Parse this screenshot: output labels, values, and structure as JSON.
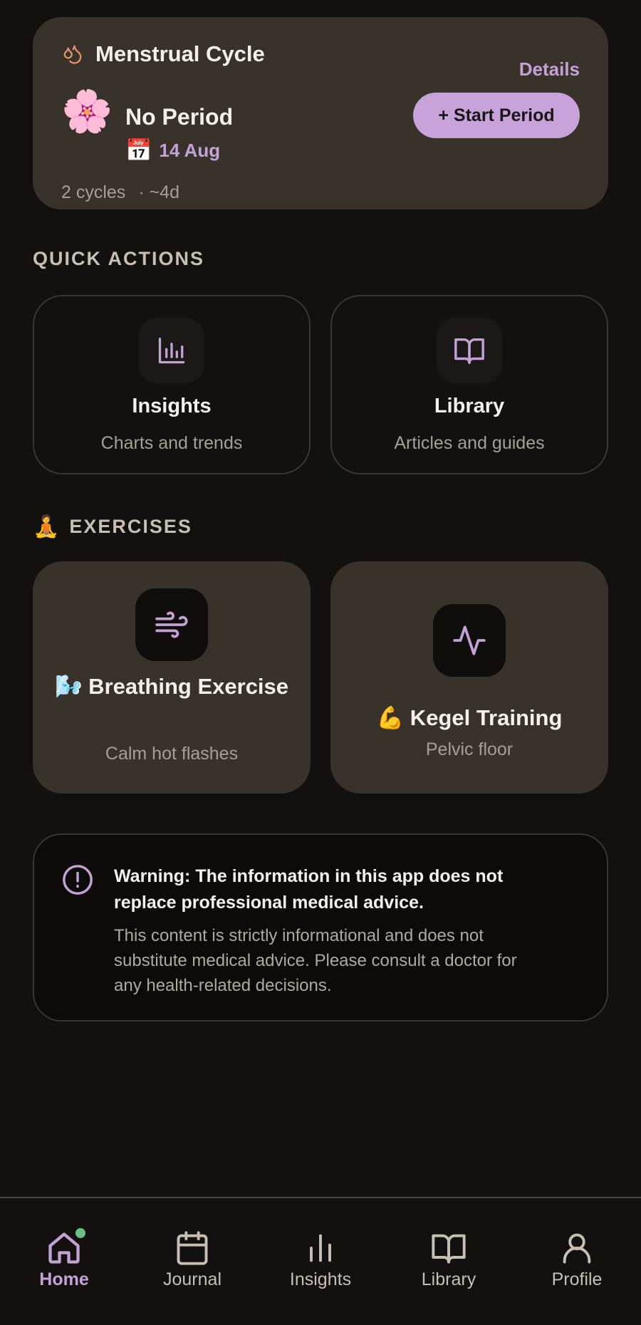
{
  "cycle": {
    "title": "Menstrual Cycle",
    "details_label": "Details",
    "status": "No Period",
    "date": "14 Aug",
    "start_button": "+ Start Period",
    "cycles_count": "2 cycles",
    "cycle_length": "· ~4d",
    "flower_emoji": "🌸",
    "calendar_emoji": "📅"
  },
  "quick_actions": {
    "title": "QUICK ACTIONS",
    "items": [
      {
        "title": "Insights",
        "subtitle": "Charts and trends",
        "icon": "bar-chart-icon"
      },
      {
        "title": "Library",
        "subtitle": "Articles and guides",
        "icon": "book-icon"
      }
    ]
  },
  "exercises": {
    "emoji": "🧘",
    "title": "EXERCISES",
    "items": [
      {
        "title": "🌬️ Breathing Exercise",
        "subtitle": "Calm hot flashes",
        "icon": "wind-icon"
      },
      {
        "title": "💪 Kegel Training",
        "subtitle": "Pelvic floor",
        "icon": "activity-icon"
      }
    ]
  },
  "warning": {
    "title": "Warning: The information in this app does not replace professional medical advice.",
    "body": "This content is strictly informational and does not substitute medical advice. Please consult a doctor for any health-related decisions."
  },
  "nav": {
    "items": [
      {
        "label": "Home",
        "icon": "home-icon",
        "active": true
      },
      {
        "label": "Journal",
        "icon": "calendar-icon",
        "active": false
      },
      {
        "label": "Insights",
        "icon": "bar-chart-icon",
        "active": false
      },
      {
        "label": "Library",
        "icon": "book-icon",
        "active": false
      },
      {
        "label": "Profile",
        "icon": "user-icon",
        "active": false
      }
    ]
  },
  "colors": {
    "accent": "#c4a2d6",
    "card": "#38322a",
    "background": "#121110",
    "notification_dot": "#6cbf84"
  }
}
